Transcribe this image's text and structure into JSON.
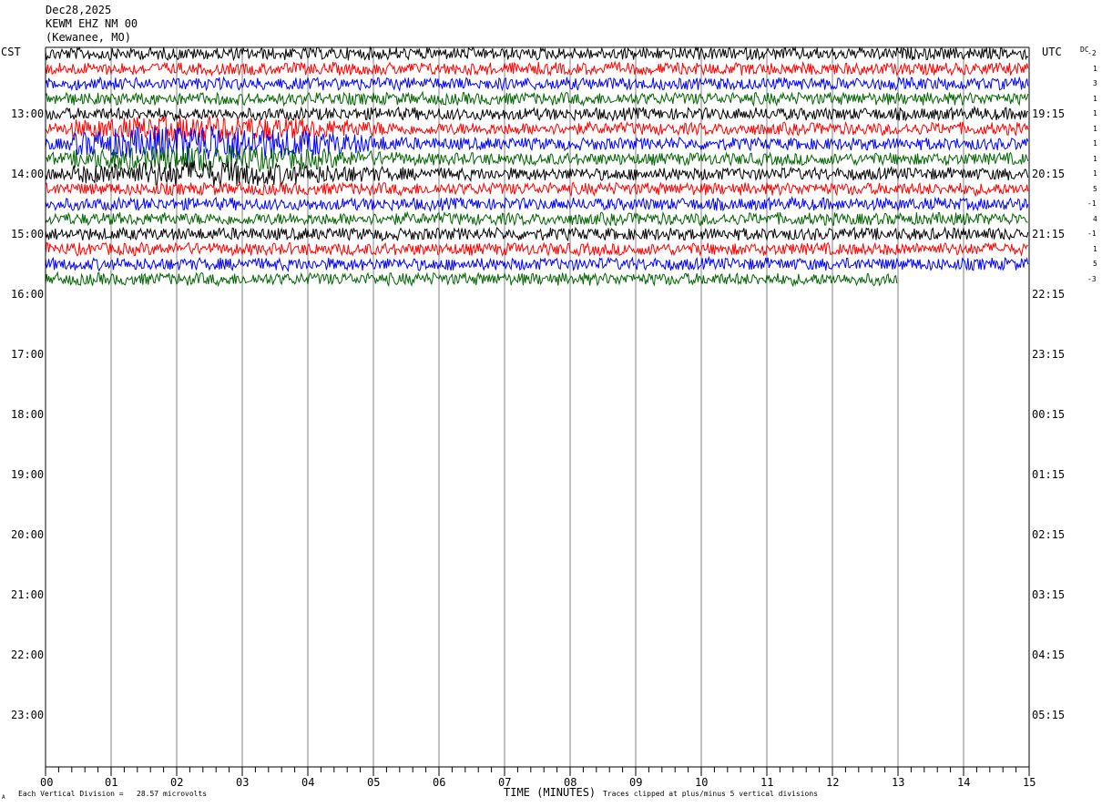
{
  "header": {
    "date": "Dec28,2025",
    "station": "KEWM EHZ NM 00",
    "location": "(Kewanee, MO)"
  },
  "axes": {
    "left_zone": "CST",
    "right_zone": "UTC",
    "dc_label": "DC",
    "xlabel": "TIME (MINUTES)"
  },
  "footer": {
    "scale_note": "Each Vertical Division =   28.57 microvolts",
    "clip_note": "Traces clipped at plus/minus 5 vertical divisions",
    "corner_mark": "A"
  },
  "colors": {
    "traces": [
      "#000000",
      "#ff0000",
      "#0000ff",
      "#006400"
    ],
    "grid": "#808080",
    "axis": "#000000"
  },
  "chart_data": {
    "type": "line",
    "subtype": "helicorder",
    "x_ticks": [
      "00",
      "01",
      "02",
      "03",
      "04",
      "05",
      "06",
      "07",
      "08",
      "09",
      "10",
      "11",
      "12",
      "13",
      "14",
      "15"
    ],
    "xlim": [
      0,
      15
    ],
    "left_hour_labels": [
      "13:00",
      "14:00",
      "15:00",
      "16:00",
      "17:00",
      "18:00",
      "19:00",
      "20:00",
      "21:00",
      "22:00",
      "23:00"
    ],
    "right_hour_labels": [
      "19:15",
      "20:15",
      "21:15",
      "22:15",
      "23:15",
      "00:15",
      "01:15",
      "02:15",
      "03:15",
      "04:15",
      "05:15"
    ],
    "dc_offsets": [
      "-2",
      "1",
      "3",
      "1",
      "1",
      "1",
      "1",
      "1",
      "1",
      "5",
      "-1",
      "4",
      "-1",
      "1",
      "5",
      "-3"
    ],
    "traces_per_hour": 4,
    "total_rows": 16,
    "last_row_end_minute": 13.0,
    "event": {
      "rows": [
        5,
        6,
        7,
        8
      ],
      "start_minute": 0.4,
      "peak_minute": 2.4,
      "end_minute": 5.5
    },
    "grid": true
  }
}
